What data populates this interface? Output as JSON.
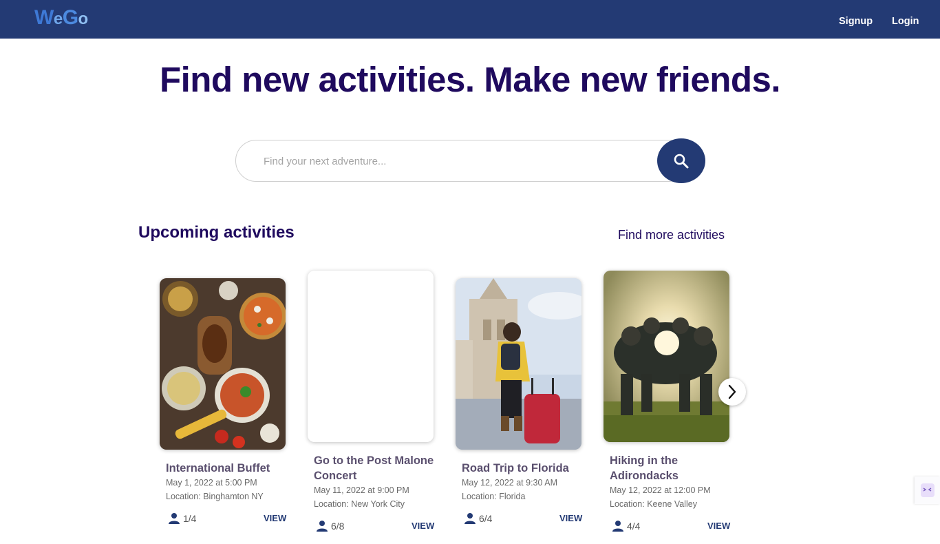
{
  "navbar": {
    "logo": {
      "w": "W",
      "e": "e",
      "g": "G",
      "o": "o"
    },
    "signup": "Signup",
    "login": "Login",
    "background": "#233a74"
  },
  "hero": {
    "title": "Find new activities. Make new friends."
  },
  "search": {
    "placeholder": "Find your next adventure...",
    "icon": "search-icon"
  },
  "section": {
    "title": "Upcoming activities",
    "find_more": "Find more activities"
  },
  "cards": [
    {
      "title": "International Buffet",
      "date": "May 1, 2022 at 5:00 PM",
      "location": "Location: Binghamton NY",
      "people": "1/4",
      "view": "VIEW",
      "image": "food-spread"
    },
    {
      "title": "Go to the Post Malone Concert",
      "date": "May 11, 2022 at 9:00 PM",
      "location": "Location: New York City",
      "people": "6/8",
      "view": "VIEW",
      "image": "blank"
    },
    {
      "title": "Road Trip to Florida",
      "date": "May 12, 2022 at 9:30 AM",
      "location": "Location: Florida",
      "people": "6/4",
      "view": "VIEW",
      "image": "traveler-with-suitcase"
    },
    {
      "title": "Hiking in the Adirondacks",
      "date": "May 12, 2022 at 12:00 PM",
      "location": "Location: Keene Valley",
      "people": "4/4",
      "view": "VIEW",
      "image": "team-huddle"
    }
  ],
  "icons": {
    "people": "person-icon",
    "next": "chevron-right-icon"
  },
  "colors": {
    "primary": "#233a74",
    "heading": "#1f0a5e"
  }
}
